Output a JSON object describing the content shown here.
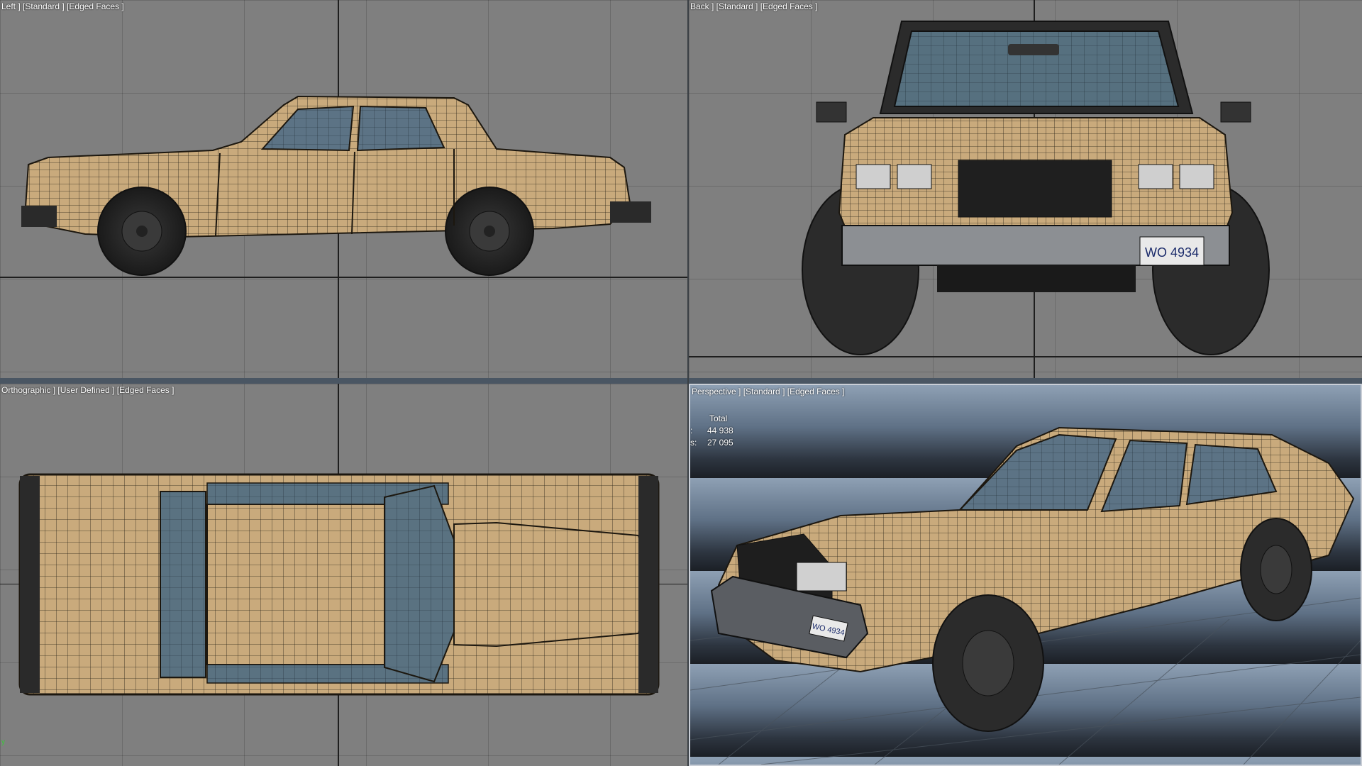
{
  "viewports": {
    "left": {
      "label": "Left ] [Standard ] [Edged Faces ]"
    },
    "back": {
      "label": "Back ] [Standard ] [Edged Faces ]"
    },
    "top": {
      "label": "Orthographic ] [User Defined ] [Edged Faces ]"
    },
    "persp": {
      "label": "Perspective ] [Standard ] [Edged Faces ]"
    }
  },
  "stats": {
    "header": "Total",
    "polys_key": ":",
    "polys": "44 938",
    "verts_key": "s:",
    "verts": "27 095"
  },
  "plate": {
    "text": "WO 4934",
    "text_persp": "WO 4934"
  },
  "colors": {
    "grid_bg": "#7f7f7f",
    "body": "#c9aa7c",
    "wire": "#2a2418",
    "glass": "#5c7385",
    "tire": "#2b2b2b",
    "chrome": "#a9acb0"
  }
}
